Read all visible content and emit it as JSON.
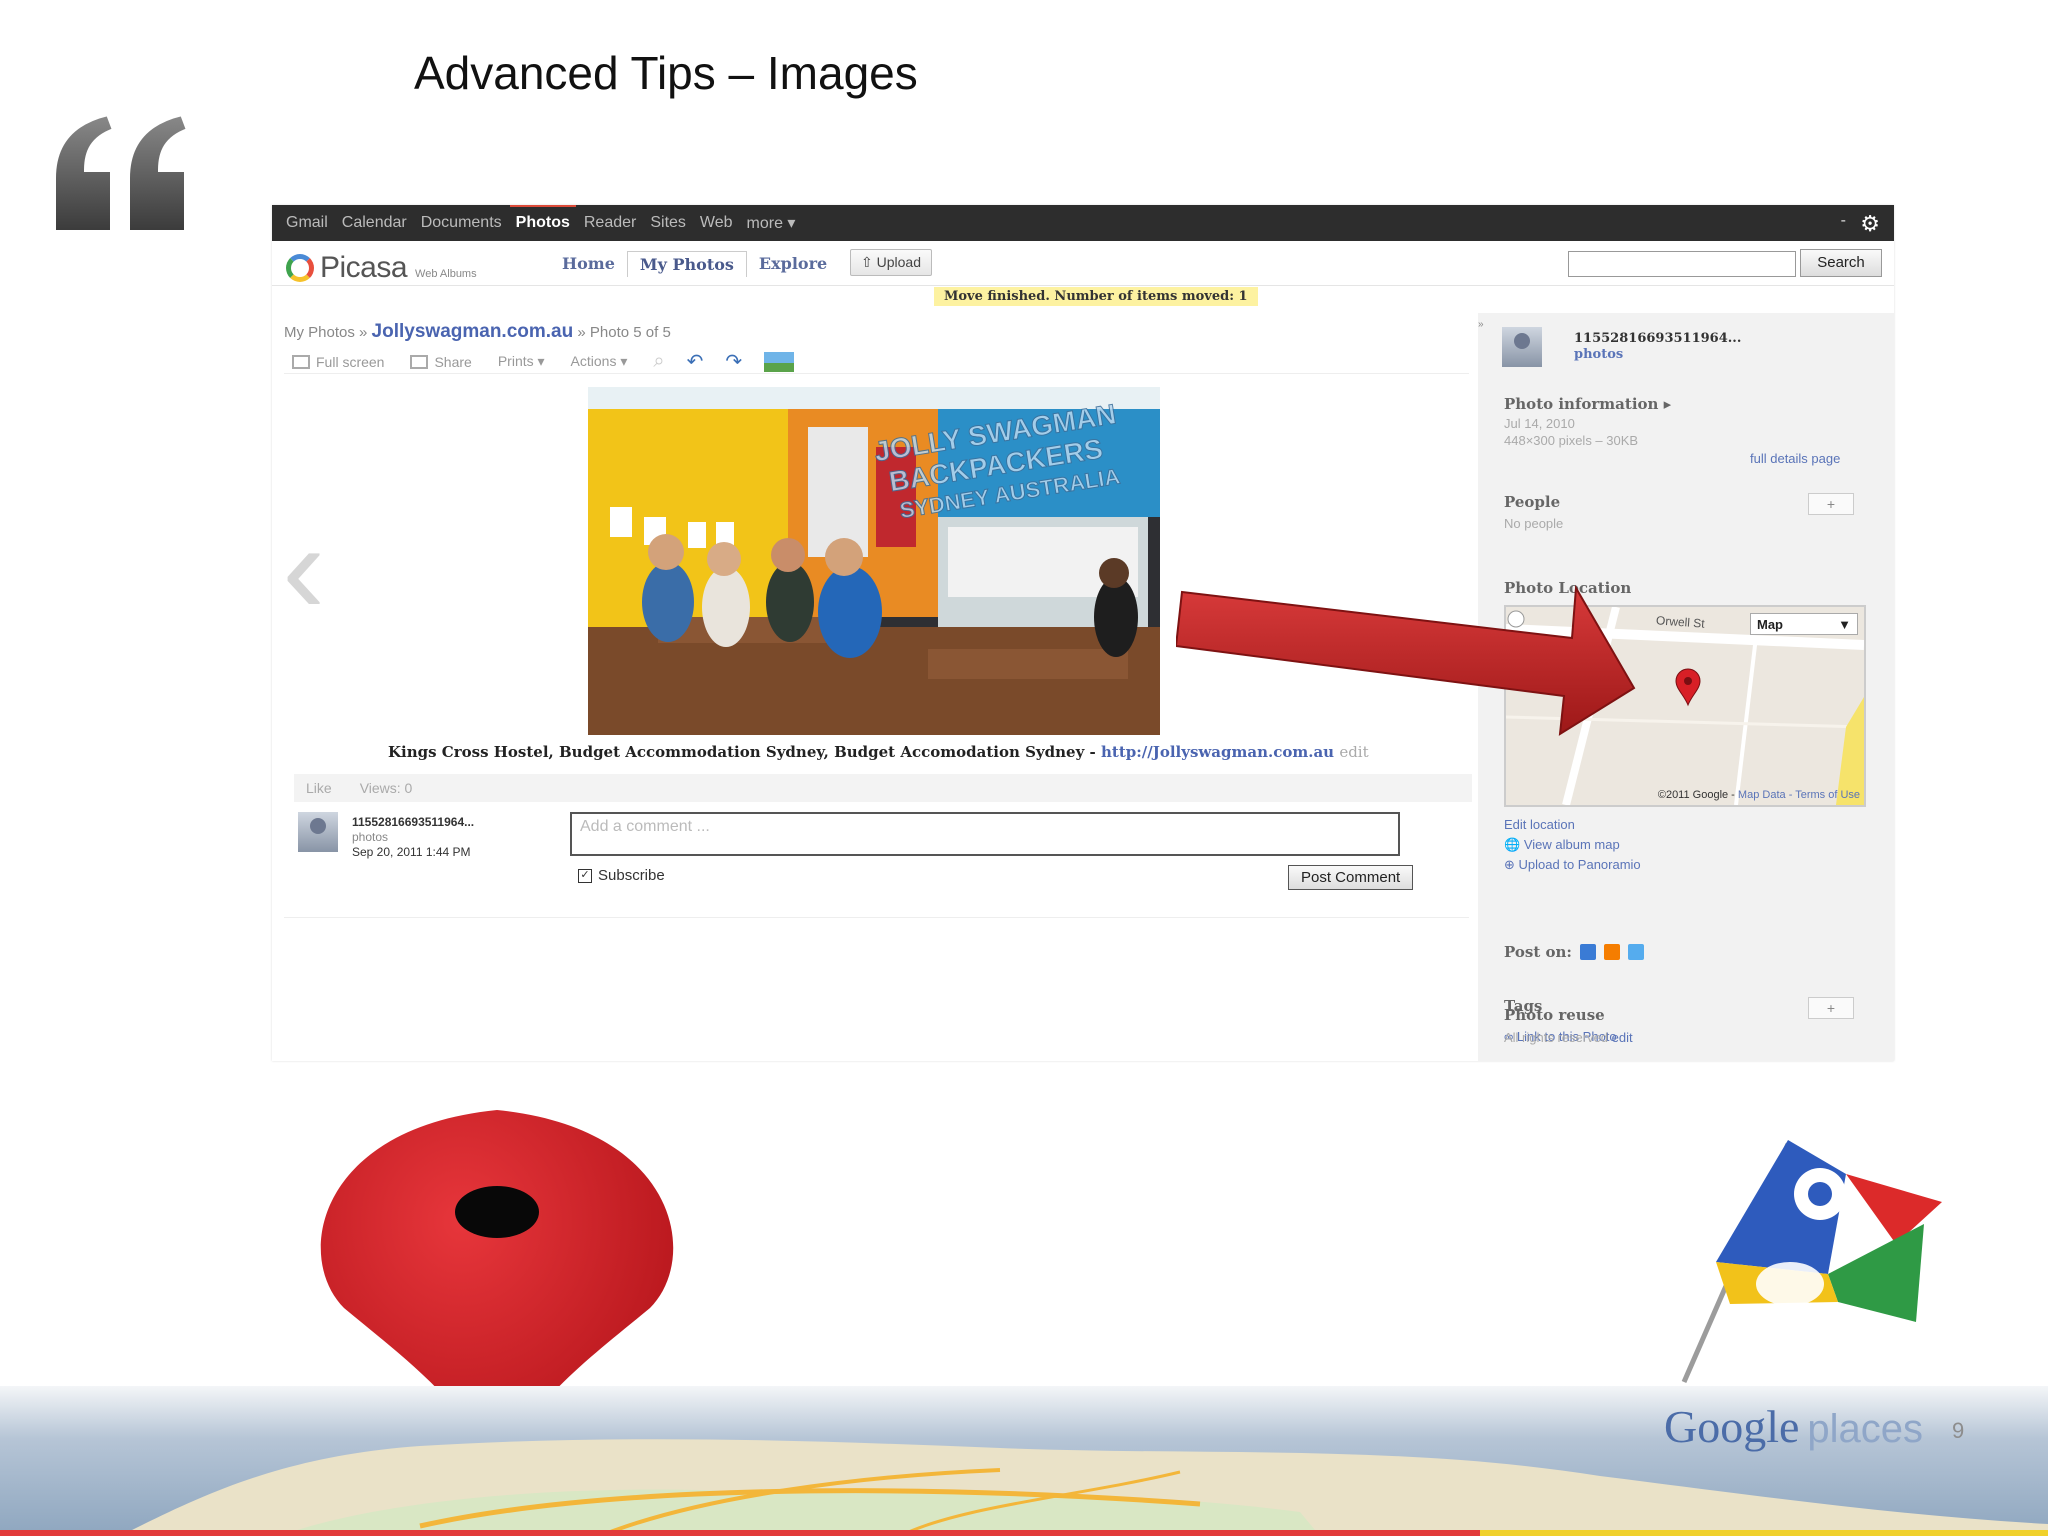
{
  "slide": {
    "title": "Advanced Tips – Images",
    "page_number": "9"
  },
  "google_bar": {
    "items": [
      "Gmail",
      "Calendar",
      "Documents",
      "Photos",
      "Reader",
      "Sites",
      "Web",
      "more ▾"
    ],
    "active": "Photos",
    "dash": "-"
  },
  "picasa": {
    "logo": "Picasa",
    "logo_sub": "Web Albums",
    "tabs": [
      "Home",
      "My Photos",
      "Explore"
    ],
    "active_tab": "My Photos",
    "upload_label": "⇧ Upload",
    "search_value": "",
    "search_label": "Search",
    "notice": "Move finished. Number of items moved: 1"
  },
  "photo_view": {
    "breadcrumb_root": "My Photos »",
    "album": "Jollyswagman.com.au",
    "position": "» Photo 5 of 5",
    "toolbar": [
      "Full screen",
      "Share",
      "Prints ▾",
      "Actions ▾"
    ],
    "photo_watermark": [
      "JOLLY SWAGMAN",
      "BACKPACKERS",
      "SYDNEY AUSTRALIA"
    ],
    "caption": "Kings Cross Hostel, Budget Accommodation Sydney, Budget Accomodation Sydney -",
    "caption_link": "http://Jollyswagman.com.au",
    "caption_edit": "edit",
    "like_label": "Like",
    "views": "Views: 0",
    "comment_user": "11552816693511964...",
    "comment_user_sub": "photos",
    "comment_date": "Sep 20, 2011 1:44 PM",
    "comment_placeholder": "Add a comment ...",
    "subscribe_label": "Subscribe",
    "post_comment_label": "Post Comment"
  },
  "sidebar": {
    "user": "11552816693511964...",
    "user_sub": "photos",
    "photo_info_title": "Photo information ▸",
    "photo_date": "Jul 14, 2010",
    "photo_size": "448×300 pixels – 30KB",
    "full_details": "full details page",
    "people_title": "People",
    "people_value": "No people",
    "people_add": "+",
    "location_title": "Photo Location",
    "map_street": "Orwell St",
    "map_type": "Map",
    "map_copyright": "©2011 Google -",
    "map_data": "Map Data",
    "map_terms": "- Terms of Use",
    "edit_location": "Edit location",
    "view_album_map": "View album map",
    "upload_panoramio": "Upload to Panoramio",
    "post_on": "Post on:",
    "tags_title": "Tags",
    "tags_add": "+",
    "link_photo": "Link to this Photo",
    "reuse_title": "Photo reuse",
    "reuse_value": "All rights reserved",
    "reuse_edit": "edit"
  },
  "branding": {
    "google": "Google",
    "places": "places"
  },
  "colors": {
    "arrow_red": "#c62a2a",
    "pin_red": "#d81f26",
    "link_blue": "#4a64b0"
  },
  "icons": [
    "quote-icon",
    "gear-icon",
    "prev-arrow-icon",
    "map-pin-icon",
    "google-places-flag-icon"
  ]
}
